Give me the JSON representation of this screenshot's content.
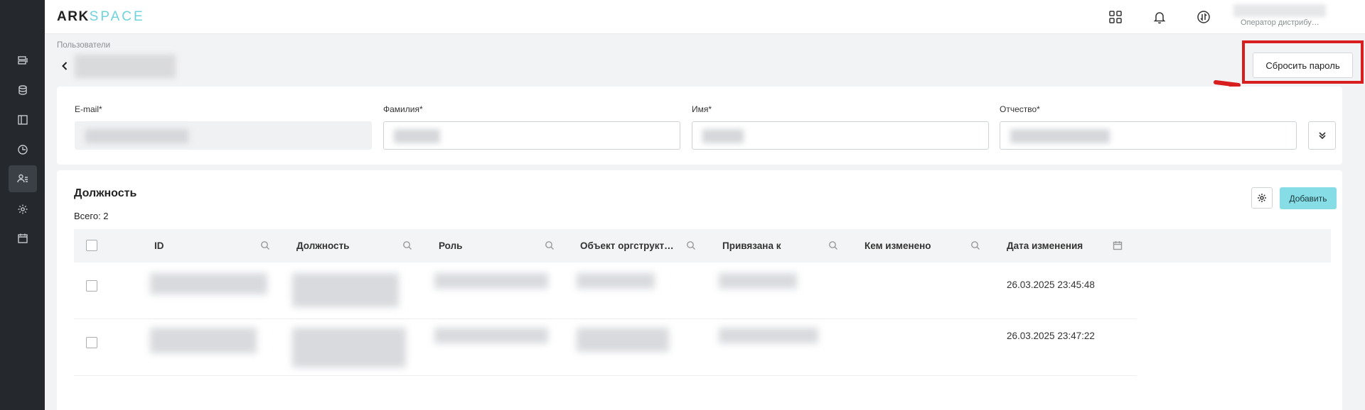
{
  "brand": {
    "part1": "ARK",
    "part2": "SPACE"
  },
  "header": {
    "icons": [
      "grid-icon",
      "bell-icon",
      "swap-icon"
    ],
    "user_role": "Оператор дистрибу…"
  },
  "sidebar": {
    "items": [
      "list-icon",
      "database-icon",
      "book-icon",
      "clock-icon",
      "users-icon",
      "gear-icon",
      "calendar-icon"
    ],
    "active_index": 4
  },
  "page": {
    "breadcrumb": "Пользователи",
    "reset_password_label": "Сбросить пароль"
  },
  "form": {
    "email_label": "E-mail*",
    "lastname_label": "Фамилия*",
    "firstname_label": "Имя*",
    "middlename_label": "Отчество*"
  },
  "positions": {
    "title": "Должность",
    "total": "Всего: 2",
    "add_label": "Добавить",
    "columns": [
      "ID",
      "Должность",
      "Роль",
      "Объект оргструкт…",
      "Привязана к",
      "Кем изменено",
      "Дата изменения"
    ],
    "rows": [
      {
        "date": "26.03.2025 23:45:48"
      },
      {
        "date": "26.03.2025 23:47:22"
      }
    ]
  },
  "colors": {
    "sidebar_bg": "#25282c",
    "accent": "#86dde5",
    "highlight": "#d81e1e"
  }
}
